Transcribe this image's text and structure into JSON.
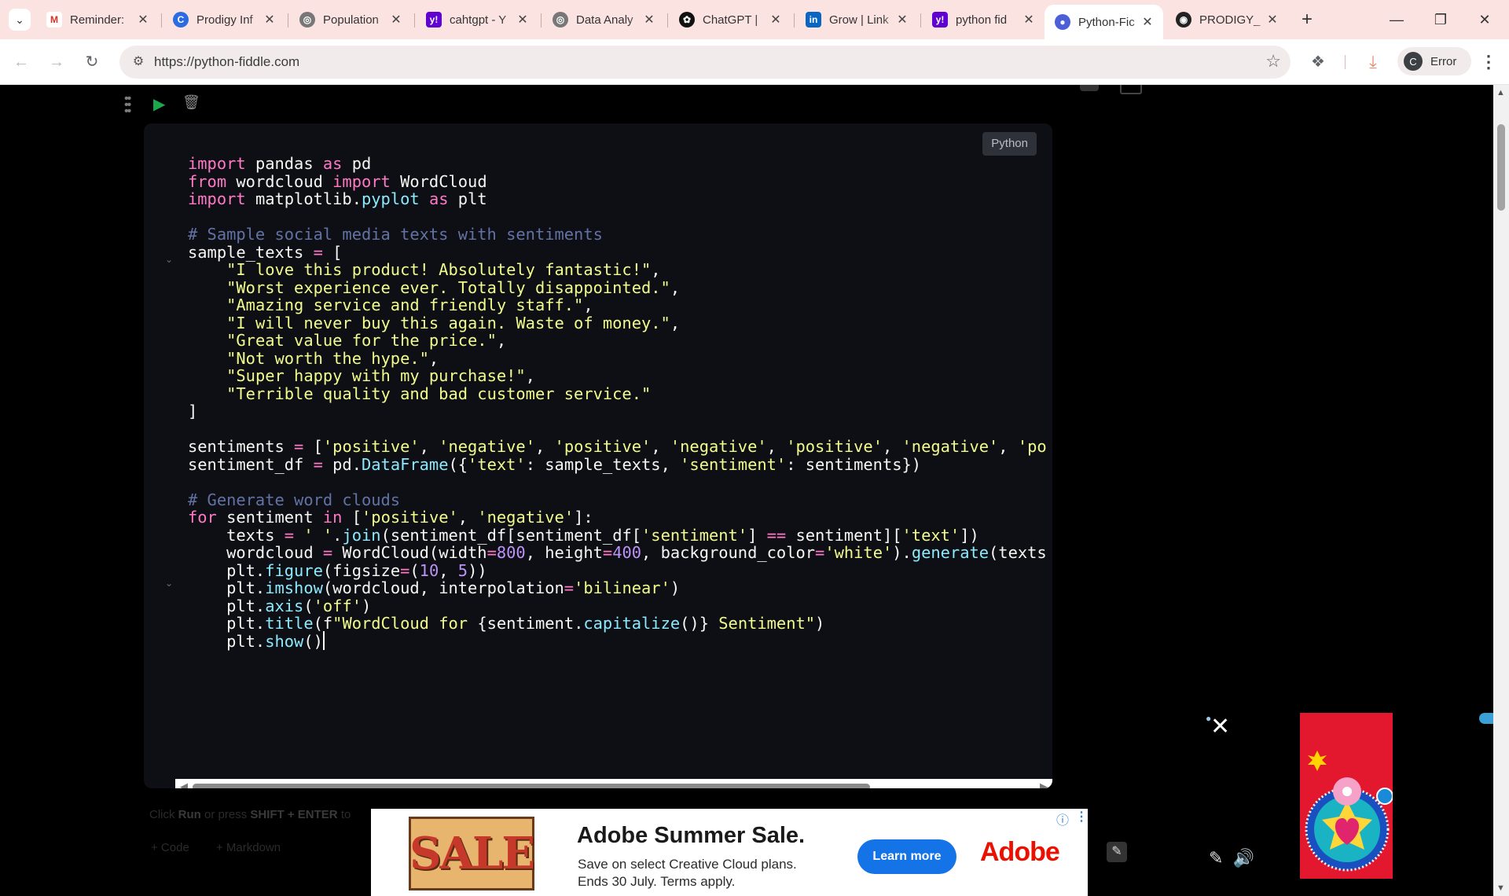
{
  "browser": {
    "tabs": [
      {
        "title": "Reminder:",
        "icon": "gmail-icon"
      },
      {
        "title": "Prodigy Inf",
        "icon": "prodigy-icon"
      },
      {
        "title": "Population",
        "icon": "globe-icon"
      },
      {
        "title": "cahtgpt - Y",
        "icon": "yahoo-icon"
      },
      {
        "title": "Data Analy",
        "icon": "globe-icon"
      },
      {
        "title": "ChatGPT |",
        "icon": "chatgpt-icon"
      },
      {
        "title": "Grow | Link",
        "icon": "linkedin-icon"
      },
      {
        "title": "python fid",
        "icon": "yahoo-icon"
      },
      {
        "title": "Python-Fic",
        "icon": "python-fiddle-icon",
        "active": true
      },
      {
        "title": "PRODIGY_",
        "icon": "github-icon"
      }
    ],
    "url": "https://python-fiddle.com",
    "profile_initial": "C",
    "profile_status": "Error"
  },
  "editor": {
    "language": "Python",
    "code_lines": [
      [
        [
          "import",
          "k"
        ],
        [
          " pandas ",
          ""
        ],
        [
          "as",
          "k"
        ],
        [
          " pd",
          ""
        ]
      ],
      [
        [
          "from",
          "k"
        ],
        [
          " wordcloud ",
          ""
        ],
        [
          "import",
          "k"
        ],
        [
          " WordCloud",
          ""
        ]
      ],
      [
        [
          "import",
          "k"
        ],
        [
          " matplotlib.",
          ""
        ],
        [
          "pyplot",
          "f"
        ],
        [
          " ",
          ""
        ],
        [
          "as",
          "k"
        ],
        [
          " plt",
          ""
        ]
      ],
      [],
      [
        [
          "# Sample social media texts with sentiments",
          "c"
        ]
      ],
      [
        [
          "sample_texts ",
          ""
        ],
        [
          "=",
          "o"
        ],
        [
          " [",
          ""
        ]
      ],
      [
        [
          "    ",
          ""
        ],
        [
          "\"I love this product! Absolutely fantastic!\"",
          "s"
        ],
        [
          ",",
          ""
        ]
      ],
      [
        [
          "    ",
          ""
        ],
        [
          "\"Worst experience ever. Totally disappointed.\"",
          "s"
        ],
        [
          ",",
          ""
        ]
      ],
      [
        [
          "    ",
          ""
        ],
        [
          "\"Amazing service and friendly staff.\"",
          "s"
        ],
        [
          ",",
          ""
        ]
      ],
      [
        [
          "    ",
          ""
        ],
        [
          "\"I will never buy this again. Waste of money.\"",
          "s"
        ],
        [
          ",",
          ""
        ]
      ],
      [
        [
          "    ",
          ""
        ],
        [
          "\"Great value for the price.\"",
          "s"
        ],
        [
          ",",
          ""
        ]
      ],
      [
        [
          "    ",
          ""
        ],
        [
          "\"Not worth the hype.\"",
          "s"
        ],
        [
          ",",
          ""
        ]
      ],
      [
        [
          "    ",
          ""
        ],
        [
          "\"Super happy with my purchase!\"",
          "s"
        ],
        [
          ",",
          ""
        ]
      ],
      [
        [
          "    ",
          ""
        ],
        [
          "\"Terrible quality and bad customer service.\"",
          "s"
        ]
      ],
      [
        [
          "]",
          ""
        ]
      ],
      [],
      [
        [
          "sentiments ",
          ""
        ],
        [
          "=",
          "o"
        ],
        [
          " [",
          ""
        ],
        [
          "'positive'",
          "s"
        ],
        [
          ", ",
          ""
        ],
        [
          "'negative'",
          "s"
        ],
        [
          ", ",
          ""
        ],
        [
          "'positive'",
          "s"
        ],
        [
          ", ",
          ""
        ],
        [
          "'negative'",
          "s"
        ],
        [
          ", ",
          ""
        ],
        [
          "'positive'",
          "s"
        ],
        [
          ", ",
          ""
        ],
        [
          "'negative'",
          "s"
        ],
        [
          ", ",
          ""
        ],
        [
          "'po",
          "s"
        ]
      ],
      [
        [
          "sentiment_df ",
          ""
        ],
        [
          "=",
          "o"
        ],
        [
          " pd.",
          ""
        ],
        [
          "DataFrame",
          "f"
        ],
        [
          "({",
          ""
        ],
        [
          "'text'",
          "s"
        ],
        [
          ": sample_texts, ",
          ""
        ],
        [
          "'sentiment'",
          "s"
        ],
        [
          ": sentiments})",
          ""
        ]
      ],
      [],
      [
        [
          "# Generate word clouds",
          "c"
        ]
      ],
      [
        [
          "for",
          "k"
        ],
        [
          " sentiment ",
          ""
        ],
        [
          "in",
          "k"
        ],
        [
          " [",
          ""
        ],
        [
          "'positive'",
          "s"
        ],
        [
          ", ",
          ""
        ],
        [
          "'negative'",
          "s"
        ],
        [
          "]:",
          ""
        ]
      ],
      [
        [
          "    texts ",
          ""
        ],
        [
          "=",
          "o"
        ],
        [
          " ",
          ""
        ],
        [
          "' '",
          "s"
        ],
        [
          ".",
          ""
        ],
        [
          "join",
          "f"
        ],
        [
          "(sentiment_df[sentiment_df[",
          ""
        ],
        [
          "'sentiment'",
          "s"
        ],
        [
          "] ",
          ""
        ],
        [
          "==",
          "o"
        ],
        [
          " sentiment][",
          ""
        ],
        [
          "'text'",
          "s"
        ],
        [
          "])",
          ""
        ]
      ],
      [
        [
          "    wordcloud ",
          ""
        ],
        [
          "=",
          "o"
        ],
        [
          " WordCloud(width",
          ""
        ],
        [
          "=",
          "o"
        ],
        [
          "800",
          "n"
        ],
        [
          ", height",
          ""
        ],
        [
          "=",
          "o"
        ],
        [
          "400",
          "n"
        ],
        [
          ", background_color",
          ""
        ],
        [
          "=",
          "o"
        ],
        [
          "'white'",
          "s"
        ],
        [
          ").",
          ""
        ],
        [
          "generate",
          "f"
        ],
        [
          "(texts",
          ""
        ]
      ],
      [
        [
          "    plt.",
          ""
        ],
        [
          "figure",
          "f"
        ],
        [
          "(figsize",
          ""
        ],
        [
          "=",
          "o"
        ],
        [
          "(",
          ""
        ],
        [
          "10",
          "n"
        ],
        [
          ", ",
          ""
        ],
        [
          "5",
          "n"
        ],
        [
          "))",
          ""
        ]
      ],
      [
        [
          "    plt.",
          ""
        ],
        [
          "imshow",
          "f"
        ],
        [
          "(wordcloud, interpolation",
          ""
        ],
        [
          "=",
          "o"
        ],
        [
          "'bilinear'",
          "s"
        ],
        [
          ")",
          ""
        ]
      ],
      [
        [
          "    plt.",
          ""
        ],
        [
          "axis",
          "f"
        ],
        [
          "(",
          ""
        ],
        [
          "'off'",
          "s"
        ],
        [
          ")",
          ""
        ]
      ],
      [
        [
          "    plt.",
          ""
        ],
        [
          "title",
          "f"
        ],
        [
          "(f",
          ""
        ],
        [
          "\"WordCloud for ",
          "s"
        ],
        [
          "{sentiment.",
          ""
        ],
        [
          "capitalize",
          "f"
        ],
        [
          "()}",
          ""
        ],
        [
          " Sentiment\"",
          "s"
        ],
        [
          ")",
          ""
        ]
      ],
      [
        [
          "    plt.",
          ""
        ],
        [
          "show",
          "f"
        ],
        [
          "()",
          ""
        ],
        [
          "",
          "cursor"
        ]
      ]
    ]
  },
  "below_cell": {
    "hint_prefix": "Click",
    "hint_run": "Run",
    "hint_mid": "or press",
    "hint_keys": "SHIFT + ENTER",
    "hint_suffix": "to",
    "add_code": "+ Code",
    "add_markdown": "+ Markdown"
  },
  "ad": {
    "sale_text": "SALE",
    "headline": "Adobe Summer Sale.",
    "subtext": "Save on select Creative Cloud plans. Ends 30 July. Terms apply.",
    "cta": "Learn more",
    "brand": "Adobe"
  },
  "colors": {
    "editor_bg": "#0e0f14",
    "keyword": "#ff79c6",
    "string": "#f1fa8c",
    "function": "#8be9fd",
    "comment": "#6272a4",
    "number": "#bd93f9",
    "run_button": "#1ba94c",
    "adobe_red": "#eb1000",
    "cta_blue": "#1473e6"
  }
}
